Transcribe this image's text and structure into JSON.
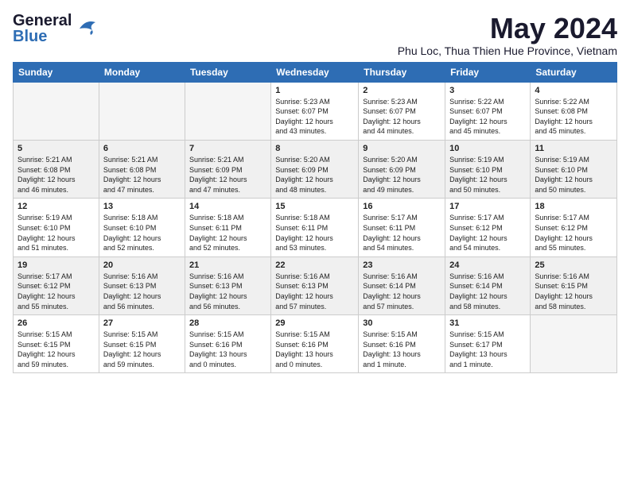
{
  "logo": {
    "general": "General",
    "blue": "Blue"
  },
  "title": "May 2024",
  "subtitle": "Phu Loc, Thua Thien Hue Province, Vietnam",
  "days_of_week": [
    "Sunday",
    "Monday",
    "Tuesday",
    "Wednesday",
    "Thursday",
    "Friday",
    "Saturday"
  ],
  "weeks": [
    [
      {
        "num": "",
        "info": ""
      },
      {
        "num": "",
        "info": ""
      },
      {
        "num": "",
        "info": ""
      },
      {
        "num": "1",
        "info": "Sunrise: 5:23 AM\nSunset: 6:07 PM\nDaylight: 12 hours\nand 43 minutes."
      },
      {
        "num": "2",
        "info": "Sunrise: 5:23 AM\nSunset: 6:07 PM\nDaylight: 12 hours\nand 44 minutes."
      },
      {
        "num": "3",
        "info": "Sunrise: 5:22 AM\nSunset: 6:07 PM\nDaylight: 12 hours\nand 45 minutes."
      },
      {
        "num": "4",
        "info": "Sunrise: 5:22 AM\nSunset: 6:08 PM\nDaylight: 12 hours\nand 45 minutes."
      }
    ],
    [
      {
        "num": "5",
        "info": "Sunrise: 5:21 AM\nSunset: 6:08 PM\nDaylight: 12 hours\nand 46 minutes."
      },
      {
        "num": "6",
        "info": "Sunrise: 5:21 AM\nSunset: 6:08 PM\nDaylight: 12 hours\nand 47 minutes."
      },
      {
        "num": "7",
        "info": "Sunrise: 5:21 AM\nSunset: 6:09 PM\nDaylight: 12 hours\nand 47 minutes."
      },
      {
        "num": "8",
        "info": "Sunrise: 5:20 AM\nSunset: 6:09 PM\nDaylight: 12 hours\nand 48 minutes."
      },
      {
        "num": "9",
        "info": "Sunrise: 5:20 AM\nSunset: 6:09 PM\nDaylight: 12 hours\nand 49 minutes."
      },
      {
        "num": "10",
        "info": "Sunrise: 5:19 AM\nSunset: 6:10 PM\nDaylight: 12 hours\nand 50 minutes."
      },
      {
        "num": "11",
        "info": "Sunrise: 5:19 AM\nSunset: 6:10 PM\nDaylight: 12 hours\nand 50 minutes."
      }
    ],
    [
      {
        "num": "12",
        "info": "Sunrise: 5:19 AM\nSunset: 6:10 PM\nDaylight: 12 hours\nand 51 minutes."
      },
      {
        "num": "13",
        "info": "Sunrise: 5:18 AM\nSunset: 6:10 PM\nDaylight: 12 hours\nand 52 minutes."
      },
      {
        "num": "14",
        "info": "Sunrise: 5:18 AM\nSunset: 6:11 PM\nDaylight: 12 hours\nand 52 minutes."
      },
      {
        "num": "15",
        "info": "Sunrise: 5:18 AM\nSunset: 6:11 PM\nDaylight: 12 hours\nand 53 minutes."
      },
      {
        "num": "16",
        "info": "Sunrise: 5:17 AM\nSunset: 6:11 PM\nDaylight: 12 hours\nand 54 minutes."
      },
      {
        "num": "17",
        "info": "Sunrise: 5:17 AM\nSunset: 6:12 PM\nDaylight: 12 hours\nand 54 minutes."
      },
      {
        "num": "18",
        "info": "Sunrise: 5:17 AM\nSunset: 6:12 PM\nDaylight: 12 hours\nand 55 minutes."
      }
    ],
    [
      {
        "num": "19",
        "info": "Sunrise: 5:17 AM\nSunset: 6:12 PM\nDaylight: 12 hours\nand 55 minutes."
      },
      {
        "num": "20",
        "info": "Sunrise: 5:16 AM\nSunset: 6:13 PM\nDaylight: 12 hours\nand 56 minutes."
      },
      {
        "num": "21",
        "info": "Sunrise: 5:16 AM\nSunset: 6:13 PM\nDaylight: 12 hours\nand 56 minutes."
      },
      {
        "num": "22",
        "info": "Sunrise: 5:16 AM\nSunset: 6:13 PM\nDaylight: 12 hours\nand 57 minutes."
      },
      {
        "num": "23",
        "info": "Sunrise: 5:16 AM\nSunset: 6:14 PM\nDaylight: 12 hours\nand 57 minutes."
      },
      {
        "num": "24",
        "info": "Sunrise: 5:16 AM\nSunset: 6:14 PM\nDaylight: 12 hours\nand 58 minutes."
      },
      {
        "num": "25",
        "info": "Sunrise: 5:16 AM\nSunset: 6:15 PM\nDaylight: 12 hours\nand 58 minutes."
      }
    ],
    [
      {
        "num": "26",
        "info": "Sunrise: 5:15 AM\nSunset: 6:15 PM\nDaylight: 12 hours\nand 59 minutes."
      },
      {
        "num": "27",
        "info": "Sunrise: 5:15 AM\nSunset: 6:15 PM\nDaylight: 12 hours\nand 59 minutes."
      },
      {
        "num": "28",
        "info": "Sunrise: 5:15 AM\nSunset: 6:16 PM\nDaylight: 13 hours\nand 0 minutes."
      },
      {
        "num": "29",
        "info": "Sunrise: 5:15 AM\nSunset: 6:16 PM\nDaylight: 13 hours\nand 0 minutes."
      },
      {
        "num": "30",
        "info": "Sunrise: 5:15 AM\nSunset: 6:16 PM\nDaylight: 13 hours\nand 1 minute."
      },
      {
        "num": "31",
        "info": "Sunrise: 5:15 AM\nSunset: 6:17 PM\nDaylight: 13 hours\nand 1 minute."
      },
      {
        "num": "",
        "info": ""
      }
    ]
  ]
}
